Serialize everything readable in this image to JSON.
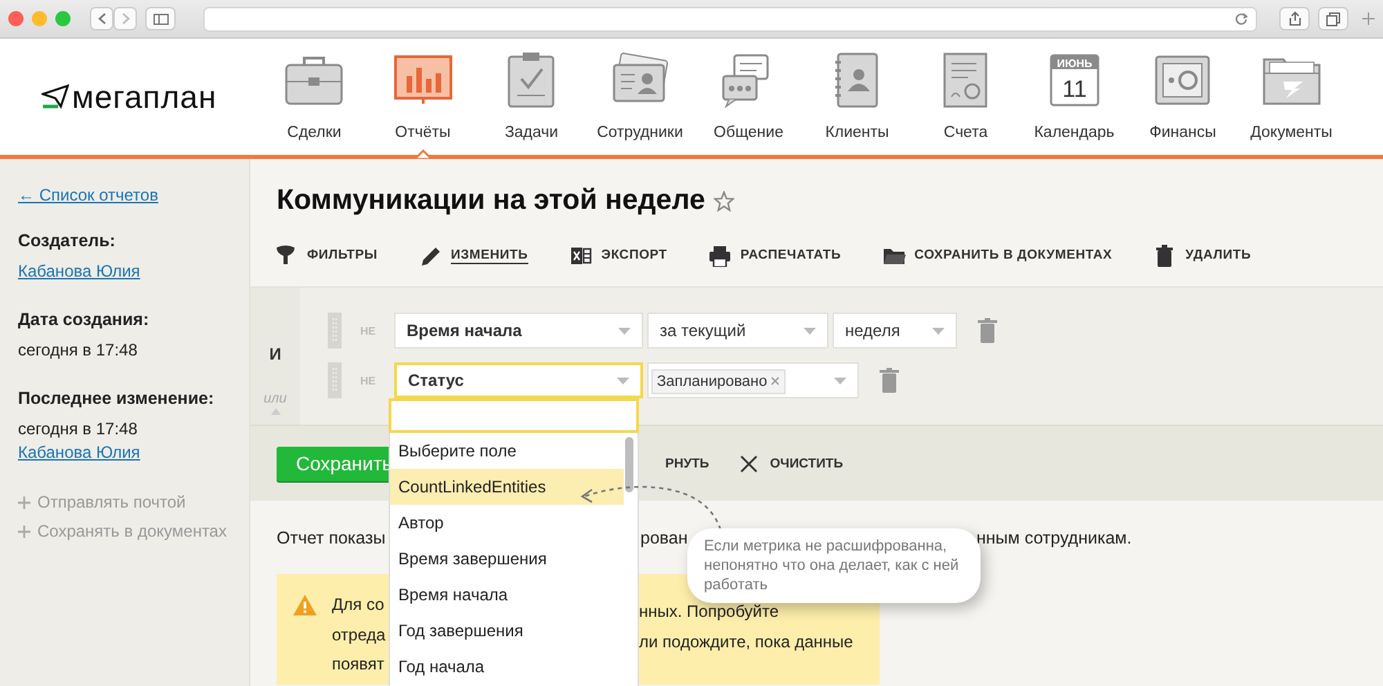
{
  "logo": {
    "text": "мегаплан"
  },
  "nav": [
    {
      "label": "Сделки",
      "kind": "briefcase",
      "selected": false
    },
    {
      "label": "Отчёты",
      "kind": "chart",
      "selected": true
    },
    {
      "label": "Задачи",
      "kind": "checklist",
      "selected": false
    },
    {
      "label": "Сотрудники",
      "kind": "cards",
      "selected": false
    },
    {
      "label": "Общение",
      "kind": "chat",
      "selected": false
    },
    {
      "label": "Клиенты",
      "kind": "contacts",
      "selected": false
    },
    {
      "label": "Счета",
      "kind": "invoice",
      "selected": false
    },
    {
      "label": "Календарь",
      "kind": "calendar",
      "month": "ИЮНЬ",
      "day": "11",
      "selected": false
    },
    {
      "label": "Финансы",
      "kind": "safe",
      "selected": false
    },
    {
      "label": "Документы",
      "kind": "folder",
      "selected": false
    }
  ],
  "sidebar": {
    "back_link": "← Список отчетов",
    "sections": [
      {
        "label": "Создатель:",
        "lines": [
          {
            "text": "Кабанова Юлия",
            "kind": "link"
          }
        ]
      },
      {
        "label": "Дата создания:",
        "lines": [
          {
            "text": "сегодня в 17:48",
            "kind": "text"
          }
        ]
      },
      {
        "label": "Последнее изменение:",
        "lines": [
          {
            "text": "сегодня в 17:48",
            "kind": "text"
          },
          {
            "text": "Кабанова Юлия",
            "kind": "link"
          }
        ]
      }
    ],
    "actions": [
      "Отправлять почтой",
      "Сохранять в документах"
    ]
  },
  "title": "Коммуникации на этой неделе",
  "starred": false,
  "toolbar": [
    {
      "label": "ФИЛЬТРЫ",
      "kind": "filter",
      "underlined": false
    },
    {
      "label": "ИЗМЕНИТЬ",
      "kind": "edit",
      "underlined": true
    },
    {
      "label": "ЭКСПОРТ",
      "kind": "export",
      "underlined": false
    },
    {
      "label": "РАСПЕЧАТАТЬ",
      "kind": "print",
      "underlined": false
    },
    {
      "label": "СОХРАНИТЬ В ДОКУМЕНТАХ",
      "kind": "save",
      "underlined": false
    },
    {
      "label": "УДАЛИТЬ",
      "kind": "delete",
      "underlined": false
    }
  ],
  "filters": {
    "conjunction": "И",
    "alternative": "или",
    "rows": [
      {
        "negation": "НЕ",
        "fields": [
          {
            "kind": "field",
            "value": "Время начала",
            "focused": false
          },
          {
            "kind": "select",
            "value": "за текущий",
            "focused": false
          },
          {
            "kind": "select",
            "value": "неделя",
            "focused": false
          }
        ]
      },
      {
        "negation": "НЕ",
        "fields": [
          {
            "kind": "field",
            "value": "Статус",
            "focused": true
          },
          {
            "kind": "tags",
            "tags": [
              "Запланировано"
            ],
            "focused": false
          }
        ]
      }
    ]
  },
  "actions": {
    "save": "Сохранить",
    "collapse": "РНУТЬ",
    "clear": "ОЧИСТИТЬ"
  },
  "description": [
    "Отчет показы",
    "рован",
    "нным сотрудникам."
  ],
  "warning": {
    "left_lines": [
      "Для со",
      "отреда",
      "появят"
    ],
    "right_lines": [
      "нных. Попробуйте",
      "ли подождите, пока данные"
    ]
  },
  "dropdown": {
    "items": [
      {
        "label": "Выберите поле",
        "selected": false
      },
      {
        "label": "CountLinkedEntities",
        "selected": true
      },
      {
        "label": "Автор",
        "selected": false
      },
      {
        "label": "Время завершения",
        "selected": false
      },
      {
        "label": "Время начала",
        "selected": false
      },
      {
        "label": "Год завершения",
        "selected": false
      },
      {
        "label": "Год начала",
        "selected": false
      }
    ]
  },
  "tooltip": {
    "text": "Если метрика не расшифрованна, непонятно что она делает, как с ней работать"
  }
}
